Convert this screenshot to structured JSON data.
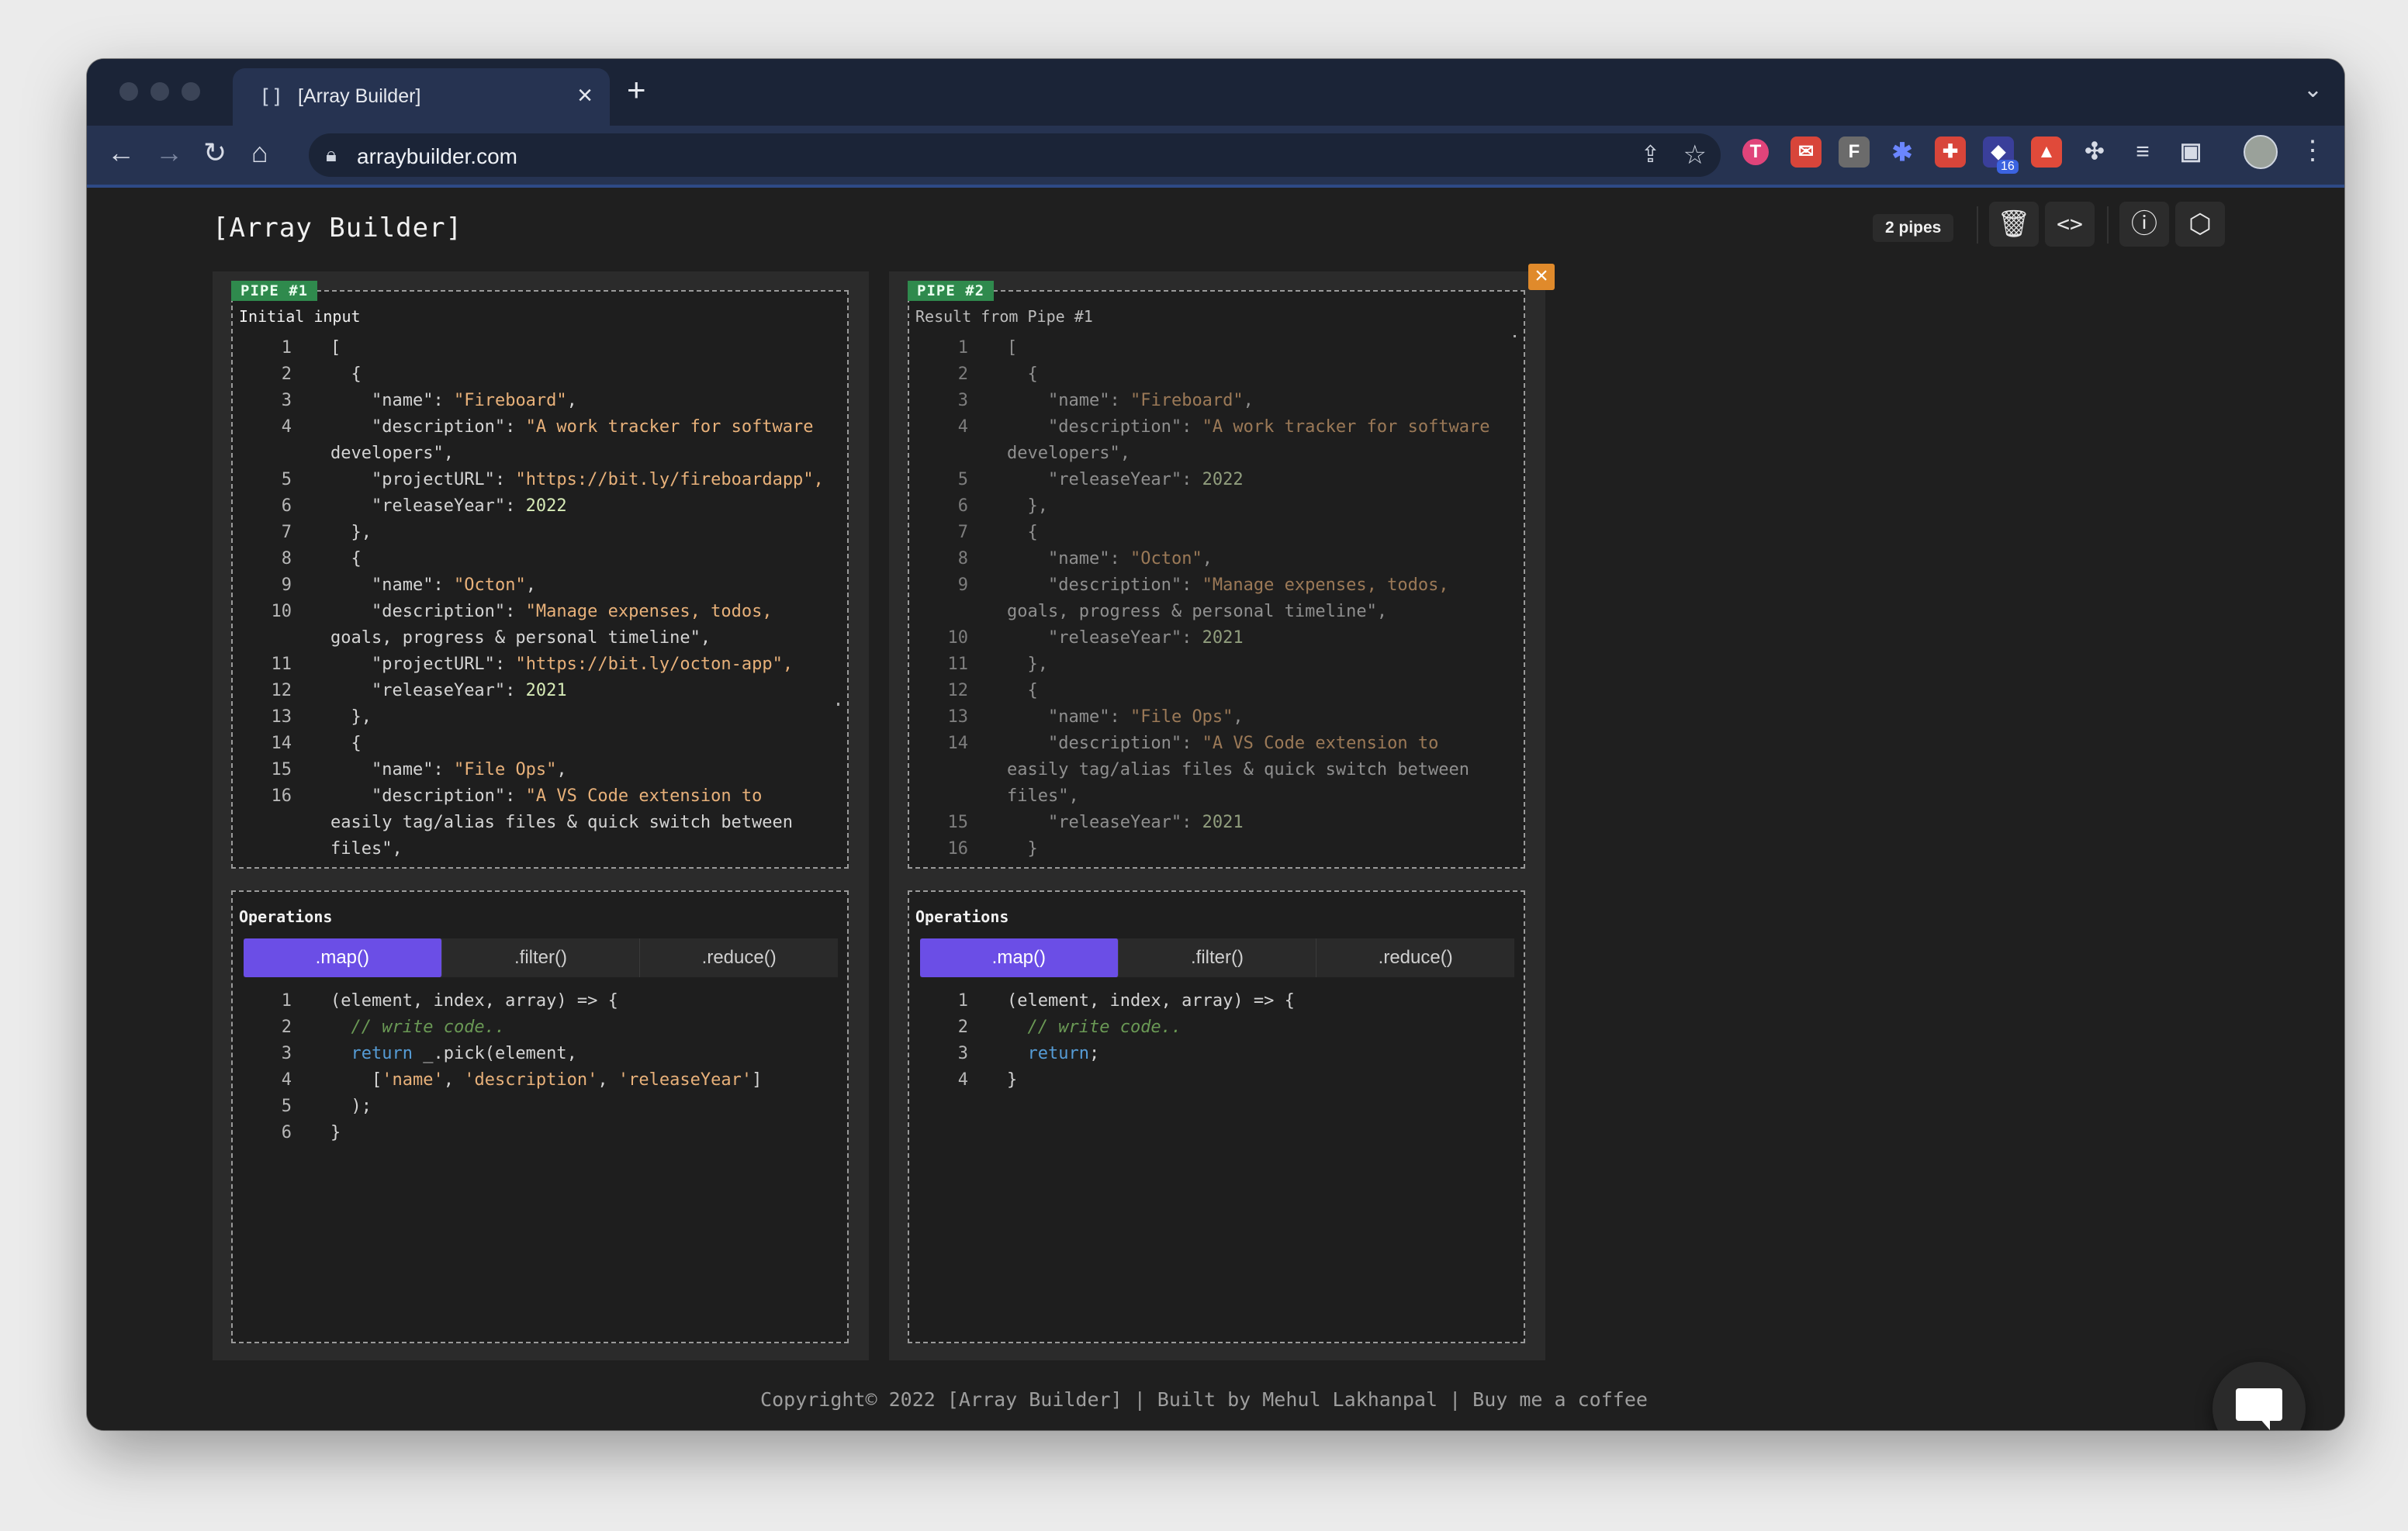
{
  "browser": {
    "tab_title": "[Array Builder]",
    "tab_favicon": "[]",
    "url": "arraybuilder.com",
    "extension_badge": "16"
  },
  "header": {
    "title": "[Array Builder]",
    "pipes_count": "2 pipes",
    "icons": [
      "trash-icon",
      "code-icon",
      "help-icon",
      "hexagon-icon"
    ]
  },
  "pipes": [
    {
      "label": "PIPE #1",
      "input_title": "Initial input",
      "operations_title": "Operations",
      "tabs": [
        ".map()",
        ".filter()",
        ".reduce()"
      ],
      "active_tab": ".map()"
    },
    {
      "label": "PIPE #2",
      "input_title": "Result from Pipe #1",
      "operations_title": "Operations",
      "tabs": [
        ".map()",
        ".filter()",
        ".reduce()"
      ],
      "active_tab": ".map()"
    }
  ],
  "pipe1_input_lines": [
    {
      "n": "1",
      "t": "["
    },
    {
      "n": "2",
      "t": "  {"
    },
    {
      "n": "3",
      "t": "    \"name\": \"Fireboard\","
    },
    {
      "n": "4",
      "t": "    \"description\": \"A work tracker for software"
    },
    {
      "n": "",
      "t": "developers\","
    },
    {
      "n": "5",
      "t": "    \"projectURL\": \"https://bit.ly/fireboardapp\","
    },
    {
      "n": "6",
      "t": "    \"releaseYear\": 2022"
    },
    {
      "n": "7",
      "t": "  },"
    },
    {
      "n": "8",
      "t": "  {"
    },
    {
      "n": "9",
      "t": "    \"name\": \"Octon\","
    },
    {
      "n": "10",
      "t": "    \"description\": \"Manage expenses, todos,"
    },
    {
      "n": "",
      "t": "goals, progress & personal timeline\","
    },
    {
      "n": "11",
      "t": "    \"projectURL\": \"https://bit.ly/octon-app\","
    },
    {
      "n": "12",
      "t": "    \"releaseYear\": 2021"
    },
    {
      "n": "13",
      "t": "  },"
    },
    {
      "n": "14",
      "t": "  {"
    },
    {
      "n": "15",
      "t": "    \"name\": \"File Ops\","
    },
    {
      "n": "16",
      "t": "    \"description\": \"A VS Code extension to"
    },
    {
      "n": "",
      "t": "easily tag/alias files & quick switch between"
    },
    {
      "n": "",
      "t": "files\","
    }
  ],
  "pipe2_input_lines": [
    {
      "n": "1",
      "t": "["
    },
    {
      "n": "2",
      "t": "  {"
    },
    {
      "n": "3",
      "t": "    \"name\": \"Fireboard\","
    },
    {
      "n": "4",
      "t": "    \"description\": \"A work tracker for software"
    },
    {
      "n": "",
      "t": "developers\","
    },
    {
      "n": "5",
      "t": "    \"releaseYear\": 2022"
    },
    {
      "n": "6",
      "t": "  },"
    },
    {
      "n": "7",
      "t": "  {"
    },
    {
      "n": "8",
      "t": "    \"name\": \"Octon\","
    },
    {
      "n": "9",
      "t": "    \"description\": \"Manage expenses, todos,"
    },
    {
      "n": "",
      "t": "goals, progress & personal timeline\","
    },
    {
      "n": "10",
      "t": "    \"releaseYear\": 2021"
    },
    {
      "n": "11",
      "t": "  },"
    },
    {
      "n": "12",
      "t": "  {"
    },
    {
      "n": "13",
      "t": "    \"name\": \"File Ops\","
    },
    {
      "n": "14",
      "t": "    \"description\": \"A VS Code extension to"
    },
    {
      "n": "",
      "t": "easily tag/alias files & quick switch between"
    },
    {
      "n": "",
      "t": "files\","
    },
    {
      "n": "15",
      "t": "    \"releaseYear\": 2021"
    },
    {
      "n": "16",
      "t": "  }"
    }
  ],
  "pipe1_code_lines": [
    {
      "n": "1",
      "t": "(element, index, array) => {"
    },
    {
      "n": "2",
      "t": "  // write code.."
    },
    {
      "n": "3",
      "t": "  return _.pick(element,"
    },
    {
      "n": "4",
      "t": "    ['name', 'description', 'releaseYear']"
    },
    {
      "n": "5",
      "t": "  );"
    },
    {
      "n": "6",
      "t": "}"
    }
  ],
  "pipe2_code_lines": [
    {
      "n": "1",
      "t": "(element, index, array) => {"
    },
    {
      "n": "2",
      "t": "  // write code.."
    },
    {
      "n": "3",
      "t": "  return;"
    },
    {
      "n": "4",
      "t": "}"
    }
  ],
  "footer": "Copyright© 2022 [Array Builder] | Built by Mehul Lakhanpal | Buy me a coffee",
  "colors": {
    "accent": "#6b4ee6",
    "pipe_label": "#2f8a4d",
    "close_button": "#e08a2b"
  }
}
